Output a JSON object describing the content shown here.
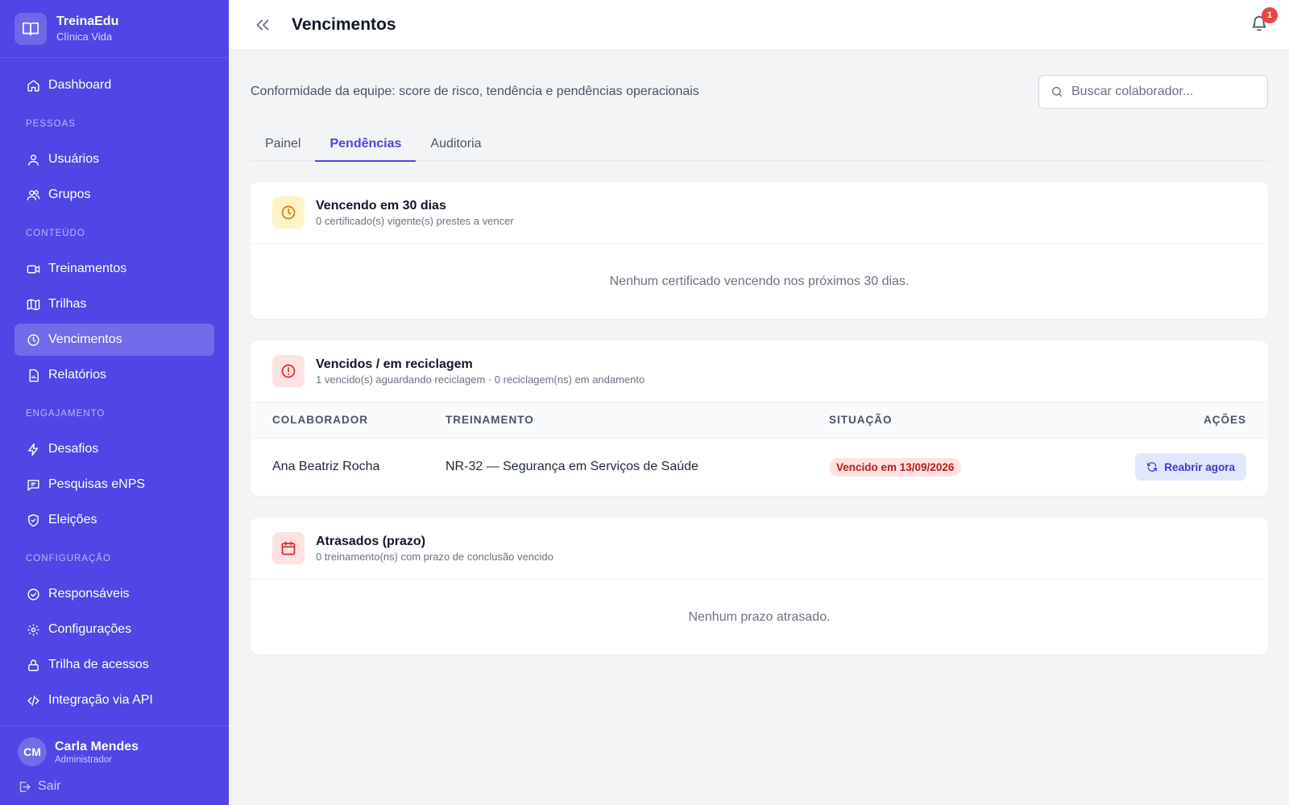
{
  "brand": {
    "name": "TreinaEdu",
    "org": "Clínica Vida"
  },
  "sidebar": {
    "dashboard": "Dashboard",
    "sections": {
      "pessoas": "PESSOAS",
      "conteudo": "CONTEÚDO",
      "engajamento": "ENGAJAMENTO",
      "configuracao": "CONFIGURAÇÃO"
    },
    "items": {
      "usuarios": "Usuários",
      "grupos": "Grupos",
      "treinamentos": "Treinamentos",
      "trilhas": "Trilhas",
      "vencimentos": "Vencimentos",
      "relatorios": "Relatórios",
      "desafios": "Desafios",
      "pesquisas": "Pesquisas eNPS",
      "eleicoes": "Eleições",
      "responsaveis": "Responsáveis",
      "configuracoes": "Configurações",
      "trilha_acessos": "Trilha de acessos",
      "integracao": "Integração via API"
    },
    "active": "vencimentos",
    "user": {
      "initials": "CM",
      "name": "Carla Mendes",
      "role": "Administrador"
    },
    "logout": "Sair"
  },
  "header": {
    "title": "Vencimentos",
    "notifications": "1"
  },
  "page": {
    "subtitle": "Conformidade da equipe: score de risco, tendência e pendências operacionais",
    "search_placeholder": "Buscar colaborador..."
  },
  "tabs": [
    {
      "label": "Painel",
      "active": false
    },
    {
      "label": "Pendências",
      "active": true
    },
    {
      "label": "Auditoria",
      "active": false
    }
  ],
  "cards": {
    "expiring": {
      "title": "Vencendo em 30 dias",
      "subtitle": "0 certificado(s) vigente(s) prestes a vencer",
      "empty": "Nenhum certificado vencendo nos próximos 30 dias."
    },
    "expired": {
      "title": "Vencidos / em reciclagem",
      "subtitle": "1 vencido(s) aguardando reciclagem · 0 reciclagem(ns) em andamento",
      "columns": [
        "COLABORADOR",
        "TREINAMENTO",
        "SITUAÇÃO",
        "AÇÕES"
      ],
      "rows": [
        {
          "colaborador": "Ana Beatriz Rocha",
          "treinamento": "NR-32 — Segurança em Serviços de Saúde",
          "situacao": "Vencido em 13/09/2026",
          "acao": "Reabrir agora"
        }
      ]
    },
    "overdue": {
      "title": "Atrasados (prazo)",
      "subtitle": "0 treinamento(ns) com prazo de conclusão vencido",
      "empty": "Nenhum prazo atrasado."
    }
  },
  "colors": {
    "sidebar": "#4f46e5",
    "accent": "#4f46e5",
    "danger": "#ef4444",
    "amber": "#d97706"
  }
}
